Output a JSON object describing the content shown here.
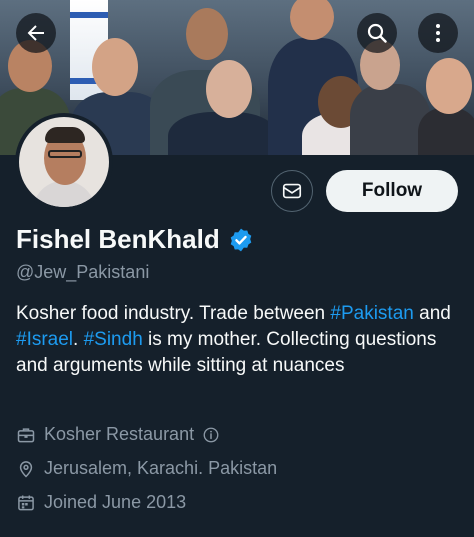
{
  "header": {
    "back_icon": "arrow-left-icon",
    "search_icon": "search-icon",
    "more_icon": "more-vertical-icon"
  },
  "actions": {
    "message_icon": "envelope-icon",
    "follow_label": "Follow"
  },
  "profile": {
    "display_name": "Fishel BenKhald",
    "verified": true,
    "handle": "@Jew_Pakistani",
    "bio": {
      "part1": "Kosher food industry. Trade between ",
      "tag1": "#Pakistan",
      "part2": " and ",
      "tag2": "#Israel",
      "part3": ". ",
      "tag3": "#Sindh",
      "part4": " is my mother. Collecting questions and arguments while sitting at nuances"
    },
    "category": "Kosher Restaurant",
    "location": "Jerusalem, Karachi. Pakistan",
    "joined": "Joined June 2013"
  },
  "colors": {
    "background": "#15202b",
    "accent": "#1d9bf0",
    "secondary_text": "#8b98a5",
    "follow_button_bg": "#eff3f4"
  }
}
